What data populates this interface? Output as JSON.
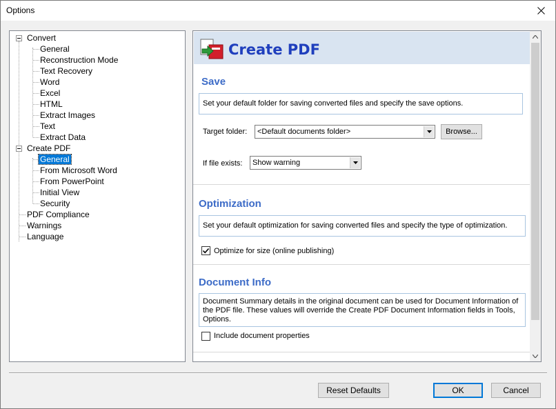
{
  "window": {
    "title": "Options",
    "close_icon": "close-icon"
  },
  "tree": {
    "items": [
      {
        "label": "Convert",
        "level": 0,
        "expander": true
      },
      {
        "label": "General",
        "level": 1
      },
      {
        "label": "Reconstruction Mode",
        "level": 1
      },
      {
        "label": "Text Recovery",
        "level": 1
      },
      {
        "label": "Word",
        "level": 1
      },
      {
        "label": "Excel",
        "level": 1
      },
      {
        "label": "HTML",
        "level": 1
      },
      {
        "label": "Extract Images",
        "level": 1
      },
      {
        "label": "Text",
        "level": 1
      },
      {
        "label": "Extract Data",
        "level": 1
      },
      {
        "label": "Create PDF",
        "level": 0,
        "expander": true
      },
      {
        "label": "General",
        "level": 1,
        "selected": true
      },
      {
        "label": "From Microsoft Word",
        "level": 1
      },
      {
        "label": "From PowerPoint",
        "level": 1
      },
      {
        "label": "Initial View",
        "level": 1
      },
      {
        "label": "Security",
        "level": 1
      },
      {
        "label": "PDF Compliance",
        "level": 0
      },
      {
        "label": "Warnings",
        "level": 0
      },
      {
        "label": "Language",
        "level": 0
      }
    ]
  },
  "banner": {
    "title": "Create PDF",
    "icon": "create-pdf-icon"
  },
  "save": {
    "title": "Save",
    "description": "Set your default folder for saving converted files and specify the save options.",
    "target_folder_label": "Target folder:",
    "target_folder_value": "<Default documents folder>",
    "browse_label": "Browse...",
    "file_exists_label": "If file exists:",
    "file_exists_value": "Show warning"
  },
  "optimization": {
    "title": "Optimization",
    "description": "Set your default optimization for saving converted files and specify the type of  optimization.",
    "optimize_label": "Optimize for size (online publishing)",
    "optimize_checked": true
  },
  "document_info": {
    "title": "Document Info",
    "description": "Document Summary details in the original document can be used for Document Information of the PDF file. These values will override the Create PDF Document Information fields in Tools, Options.",
    "include_label": "Include document properties",
    "include_checked": false
  },
  "footer": {
    "reset_label": "Reset Defaults",
    "ok_label": "OK",
    "cancel_label": "Cancel"
  },
  "colors": {
    "accent": "#0078d7",
    "section_title": "#3c6bc7",
    "banner_title": "#1f3fbd",
    "banner_bg": "#d9e4f1"
  }
}
